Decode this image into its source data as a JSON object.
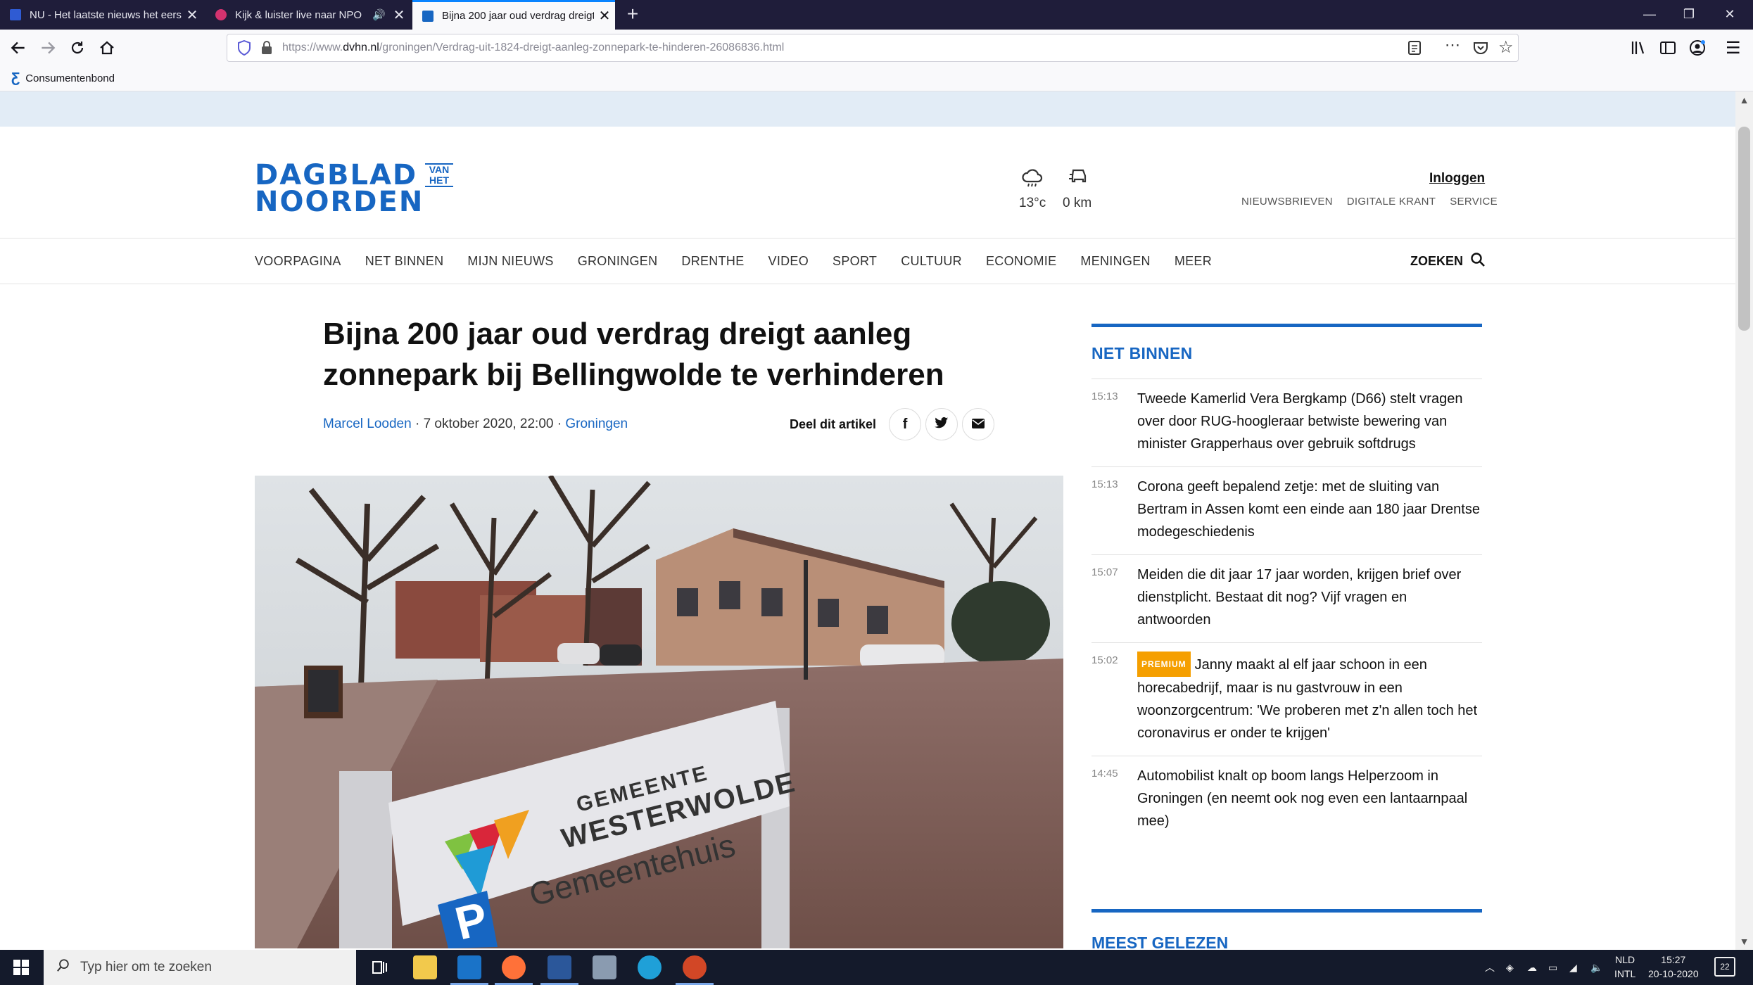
{
  "browser": {
    "tabs": [
      {
        "title": "NU - Het laatste nieuws het eerst",
        "icon_color": "#2f5bd3"
      },
      {
        "title": "Kijk & luister live naar NPO",
        "icon_color": "#d3336f"
      },
      {
        "title": "Bijna 200 jaar oud verdrag dreigt",
        "icon_color": "#1766c2"
      }
    ],
    "url_prefix": "https://www.",
    "url_domain": "dvhn.nl",
    "url_path": "/groningen/Verdrag-uit-1824-dreigt-aanleg-zonnepark-te-hinderen-26086836.html",
    "bookmark": "Consumentenbond"
  },
  "site": {
    "logo_line1": "DAGBLAD",
    "logo_line2": "NOORDEN",
    "logo_small_1": "VAN",
    "logo_small_2": "HET",
    "weather_temp": "13°c",
    "traffic_km": "0 km",
    "login": "Inloggen",
    "util_links": [
      "NIEUWSBRIEVEN",
      "DIGITALE KRANT",
      "SERVICE"
    ],
    "nav": [
      "VOORPAGINA",
      "NET BINNEN",
      "MIJN NIEUWS",
      "GRONINGEN",
      "DRENTHE",
      "VIDEO",
      "SPORT",
      "CULTUUR",
      "ECONOMIE",
      "MENINGEN",
      "MEER"
    ],
    "search_label": "ZOEKEN",
    "accent_color": "#1766c2"
  },
  "article": {
    "headline": "Bijna 200 jaar oud verdrag dreigt aanleg zonnepark bij Bellingwolde te verhinderen",
    "author": "Marcel Looden",
    "date": "· 7 oktober 2020, 22:00 ·",
    "section": "Groningen",
    "share_label": "Deel dit artikel",
    "photo_sign_line1": "GEMEENTE",
    "photo_sign_line2": "WESTERWOLDE",
    "photo_sign_line3": "Gemeentehuis"
  },
  "sidebar": {
    "heading": "NET BINNEN",
    "items": [
      {
        "time": "15:13",
        "text": "Tweede Kamerlid Vera Bergkamp (D66) stelt vragen over door RUG-hoogleraar betwiste bewering van minister Grapperhaus over gebruik softdrugs",
        "premium": ""
      },
      {
        "time": "15:13",
        "text": "Corona geeft bepalend zetje: met de sluiting van Bertram in Assen komt een einde aan 180 jaar Drentse modegeschiedenis",
        "premium": ""
      },
      {
        "time": "15:07",
        "text": "Meiden die dit jaar 17 jaar worden, krijgen brief over dienstplicht. Bestaat dit nog? Vijf vragen en antwoorden",
        "premium": ""
      },
      {
        "time": "15:02",
        "text": "Janny maakt al elf jaar schoon in een horecabedrijf, maar is nu gastvrouw in een woonzorgcentrum: 'We proberen met z'n allen toch het coronavirus er onder te krijgen'",
        "premium": "PREMIUM"
      },
      {
        "time": "14:45",
        "text": "Automobilist knalt op boom langs Helperzoom in Groningen (en neemt ook nog even een lantaarnpaal mee)",
        "premium": ""
      }
    ],
    "heading2": "MEEST GELEZEN"
  },
  "taskbar": {
    "search_placeholder": "Typ hier om te zoeken",
    "lang_1": "NLD",
    "lang_2": "INTL",
    "time": "15:27",
    "date": "20-10-2020",
    "notif_count": "22"
  }
}
